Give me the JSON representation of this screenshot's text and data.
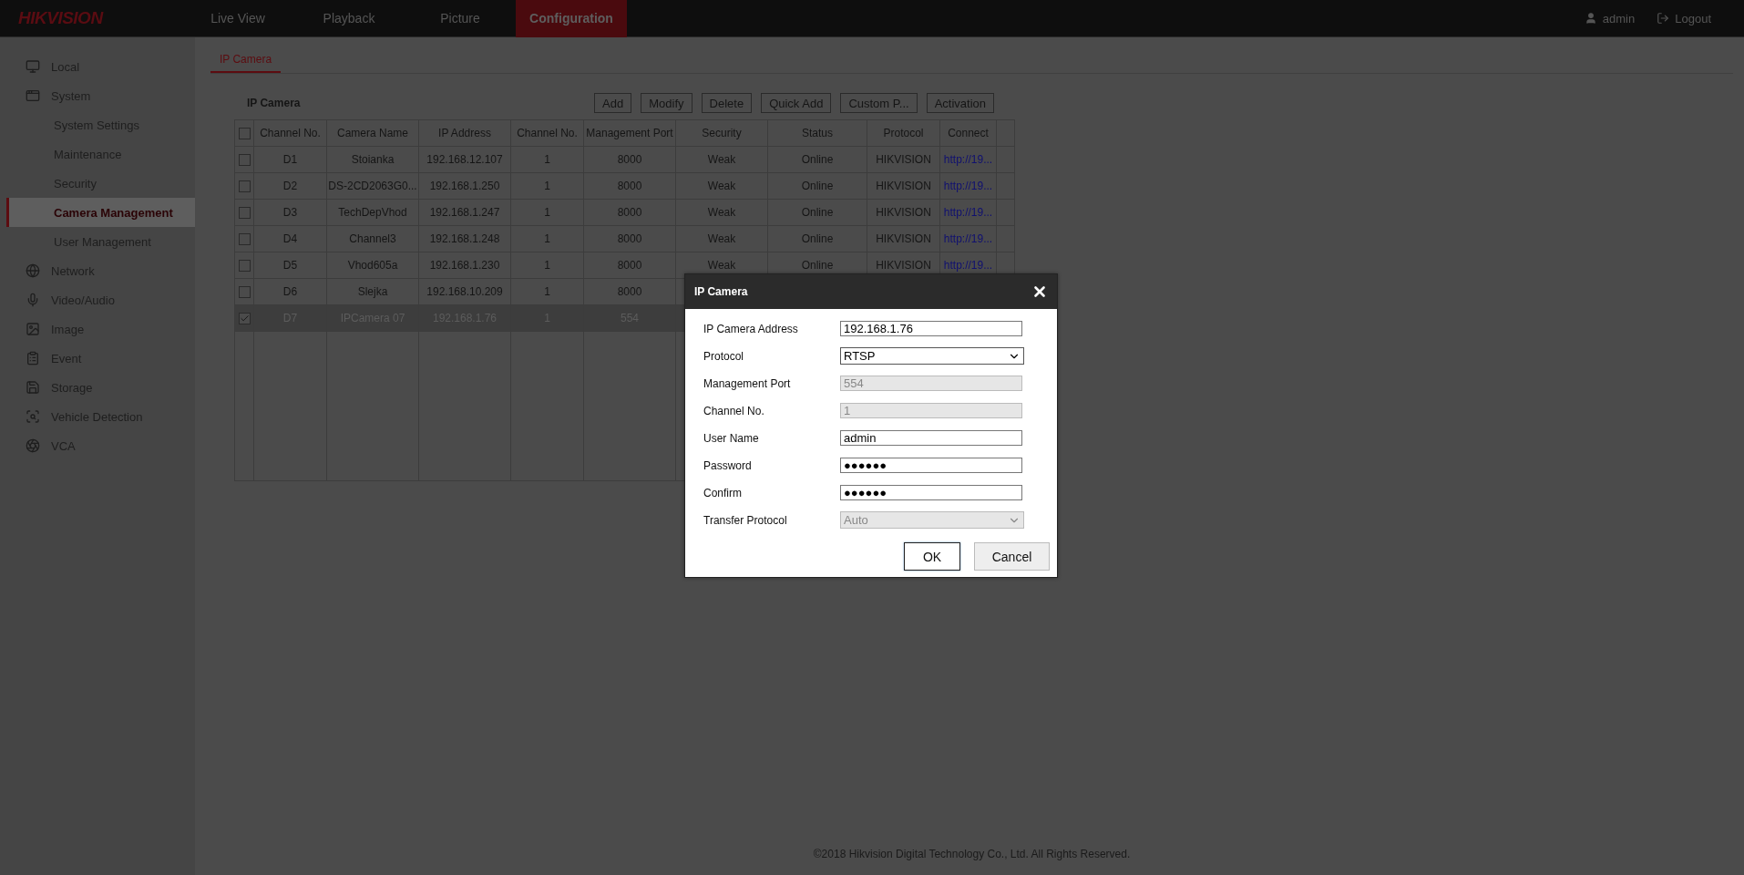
{
  "header": {
    "logo": "HIKVISION",
    "nav": [
      {
        "label": "Live View",
        "selected": false
      },
      {
        "label": "Playback",
        "selected": false
      },
      {
        "label": "Picture",
        "selected": false
      },
      {
        "label": "Configuration",
        "selected": true
      }
    ],
    "user": "admin",
    "logout": "Logout"
  },
  "sidebar": {
    "items": [
      {
        "label": "Local",
        "kind": "section",
        "selected": false
      },
      {
        "label": "System",
        "kind": "section",
        "selected": false
      },
      {
        "label": "System Settings",
        "kind": "sub",
        "selected": false
      },
      {
        "label": "Maintenance",
        "kind": "sub",
        "selected": false
      },
      {
        "label": "Security",
        "kind": "sub",
        "selected": false
      },
      {
        "label": "Camera Management",
        "kind": "sub",
        "selected": true
      },
      {
        "label": "User Management",
        "kind": "sub",
        "selected": false
      },
      {
        "label": "Network",
        "kind": "section",
        "selected": false
      },
      {
        "label": "Video/Audio",
        "kind": "section",
        "selected": false
      },
      {
        "label": "Image",
        "kind": "section",
        "selected": false
      },
      {
        "label": "Event",
        "kind": "section",
        "selected": false
      },
      {
        "label": "Storage",
        "kind": "section",
        "selected": false
      },
      {
        "label": "Vehicle Detection",
        "kind": "section",
        "selected": false
      },
      {
        "label": "VCA",
        "kind": "section",
        "selected": false
      }
    ]
  },
  "tabs": [
    {
      "label": "IP Camera",
      "selected": true
    }
  ],
  "panel": {
    "title": "IP Camera",
    "buttons": [
      "Add",
      "Modify",
      "Delete",
      "Quick Add",
      "Custom P...",
      "Activation"
    ],
    "table": {
      "all_checked": false,
      "columns": [
        "Channel No.",
        "Camera Name",
        "IP Address",
        "Channel No.",
        "Management Port",
        "Security",
        "Status",
        "Protocol",
        "Connect"
      ],
      "rows": [
        {
          "checked": false,
          "selected": false,
          "cells": [
            "D1",
            "Stoianka",
            "192.168.12.107",
            "1",
            "8000",
            "Weak",
            "Online",
            "HIKVISION",
            "http://19..."
          ]
        },
        {
          "checked": false,
          "selected": false,
          "cells": [
            "D2",
            "DS-2CD2063G0...",
            "192.168.1.250",
            "1",
            "8000",
            "Weak",
            "Online",
            "HIKVISION",
            "http://19..."
          ]
        },
        {
          "checked": false,
          "selected": false,
          "cells": [
            "D3",
            "TechDepVhod",
            "192.168.1.247",
            "1",
            "8000",
            "Weak",
            "Online",
            "HIKVISION",
            "http://19..."
          ]
        },
        {
          "checked": false,
          "selected": false,
          "cells": [
            "D4",
            "Channel3",
            "192.168.1.248",
            "1",
            "8000",
            "Weak",
            "Online",
            "HIKVISION",
            "http://19..."
          ]
        },
        {
          "checked": false,
          "selected": false,
          "cells": [
            "D5",
            "Vhod605a",
            "192.168.1.230",
            "1",
            "8000",
            "Weak",
            "Online",
            "HIKVISION",
            "http://19..."
          ]
        },
        {
          "checked": false,
          "selected": false,
          "cells": [
            "D6",
            "Slejka",
            "192.168.10.209",
            "1",
            "8000"
          ]
        },
        {
          "checked": true,
          "selected": true,
          "cells": [
            "D7",
            "IPCamera 07",
            "192.168.1.76",
            "1",
            "554"
          ]
        }
      ]
    }
  },
  "dialog": {
    "title": "IP Camera",
    "fields": [
      {
        "label": "IP Camera Address",
        "kind": "text",
        "value": "192.168.1.76",
        "disabled": false
      },
      {
        "label": "Protocol",
        "kind": "select",
        "value": "RTSP",
        "disabled": false
      },
      {
        "label": "Management Port",
        "kind": "text",
        "value": "554",
        "disabled": true
      },
      {
        "label": "Channel No.",
        "kind": "text",
        "value": "1",
        "disabled": true
      },
      {
        "label": "User Name",
        "kind": "text",
        "value": "admin",
        "disabled": false
      },
      {
        "label": "Password",
        "kind": "text",
        "value": "●●●●●●",
        "disabled": false
      },
      {
        "label": "Confirm",
        "kind": "text",
        "value": "●●●●●●",
        "disabled": false
      },
      {
        "label": "Transfer Protocol",
        "kind": "select",
        "value": "Auto",
        "disabled": true
      }
    ],
    "buttons": [
      {
        "label": "OK",
        "primary": true
      },
      {
        "label": "Cancel",
        "primary": false
      }
    ]
  },
  "footer": "©2018 Hikvision Digital Technology Co., Ltd. All Rights Reserved."
}
